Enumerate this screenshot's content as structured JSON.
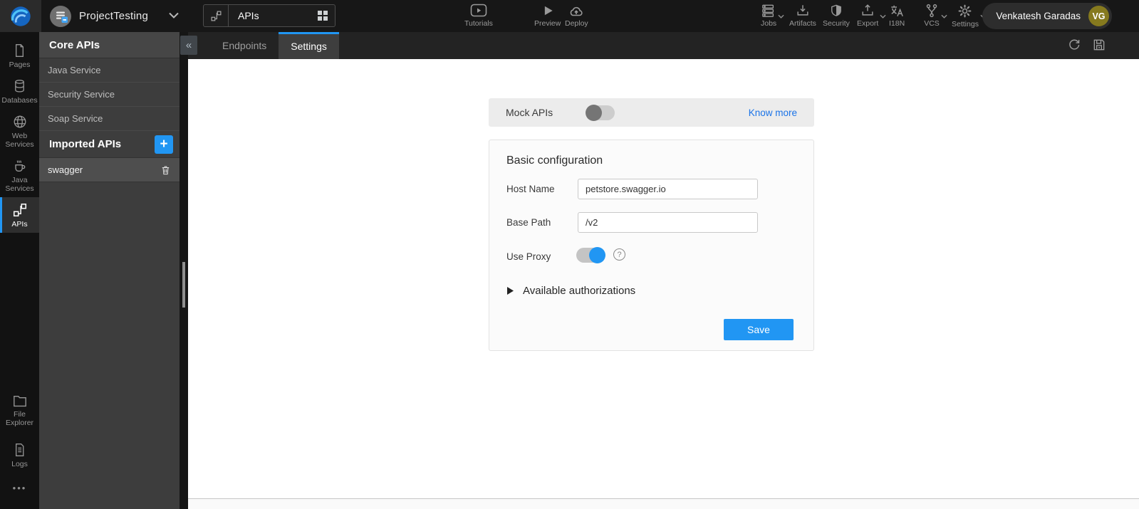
{
  "colors": {
    "accent": "#2196f3",
    "link": "#1a73e8",
    "avatar_bg": "#867a1e",
    "toggle_off_knob": "#757575",
    "sidebar_bg": "#121212",
    "panel_bg": "#3d3d3d",
    "header_bg": "#171717"
  },
  "header": {
    "project": {
      "name": "ProjectTesting"
    },
    "nav_selector": {
      "label": "APIs"
    },
    "center_actions": [
      {
        "label": "Tutorials"
      },
      {
        "label": "Preview"
      },
      {
        "label": "Deploy"
      }
    ],
    "right_actions": [
      {
        "label": "Jobs"
      },
      {
        "label": "Artifacts"
      },
      {
        "label": "Security"
      },
      {
        "label": "Export"
      },
      {
        "label": "I18N"
      },
      {
        "label": "VCS"
      },
      {
        "label": "Settings"
      }
    ],
    "user": {
      "name": "Venkatesh Garadas",
      "initials": "VG"
    }
  },
  "sidebar": {
    "items": [
      {
        "label": "Pages"
      },
      {
        "label": "Databases"
      },
      {
        "label": "Web Services"
      },
      {
        "label": "Java Services"
      },
      {
        "label": "APIs",
        "active": true
      },
      {
        "label": "File Explorer"
      },
      {
        "label": "Logs"
      }
    ],
    "overflow_glyph": "•••"
  },
  "panel": {
    "core_header": "Core APIs",
    "collapse_glyph": "«",
    "core_items": [
      {
        "label": "Java Service"
      },
      {
        "label": "Security Service"
      },
      {
        "label": "Soap Service"
      }
    ],
    "imported_header": "Imported APIs",
    "add_glyph": "+",
    "imported_items": [
      {
        "label": "swagger",
        "selected": true
      }
    ]
  },
  "tabbar": {
    "tabs": [
      {
        "label": "Endpoints"
      },
      {
        "label": "Settings",
        "active": true
      }
    ]
  },
  "content": {
    "mock": {
      "label": "Mock APIs",
      "enabled": false,
      "link": "Know more"
    },
    "config": {
      "title": "Basic configuration",
      "fields": [
        {
          "label": "Host Name",
          "value": "petstore.swagger.io"
        },
        {
          "label": "Base Path",
          "value": "/v2"
        }
      ],
      "proxy": {
        "label": "Use Proxy",
        "enabled": true,
        "help_glyph": "?"
      },
      "authorizations": {
        "label": "Available authorizations"
      },
      "save": "Save"
    }
  }
}
